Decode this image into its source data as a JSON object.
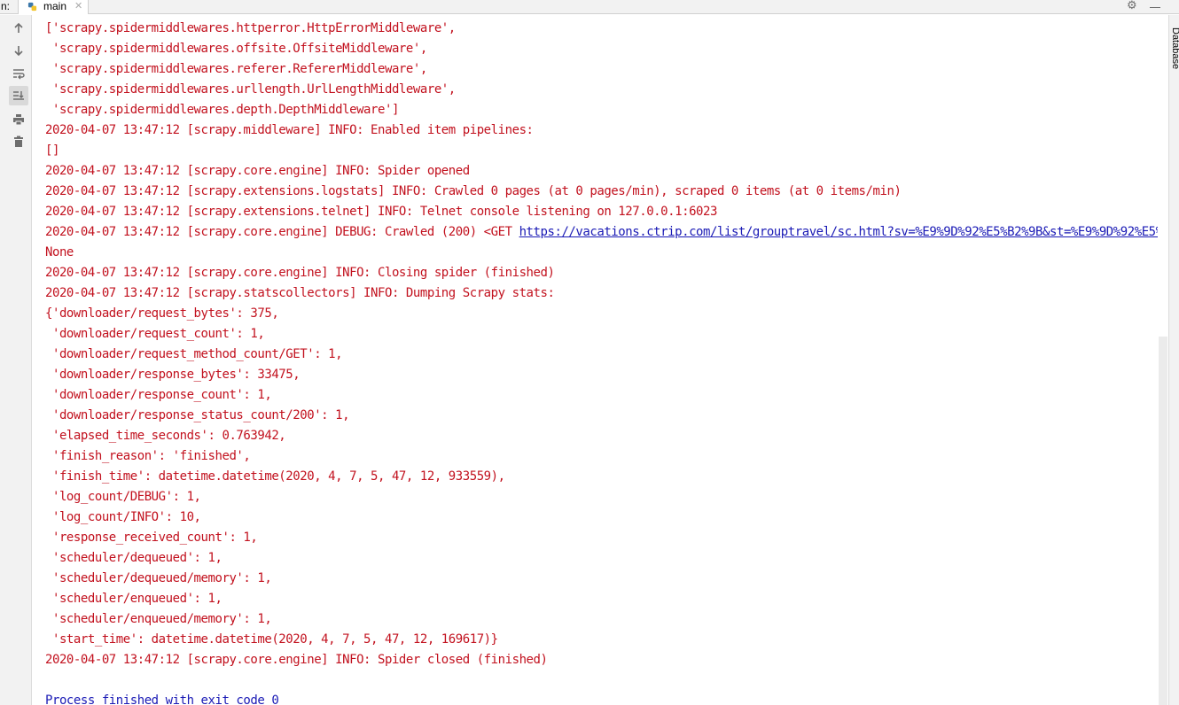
{
  "titlebar": {
    "run_label": "n:",
    "tab_label": "main",
    "close_glyph": "✕",
    "gear_glyph": "⚙"
  },
  "toolbar": {
    "buttons": [
      {
        "name": "up-arrow-icon",
        "active": false
      },
      {
        "name": "down-arrow-icon",
        "active": false
      },
      {
        "name": "soft-wrap-icon",
        "active": false
      },
      {
        "name": "scroll-to-end-icon",
        "active": true
      },
      {
        "name": "print-icon",
        "active": false
      },
      {
        "name": "trash-icon",
        "active": false
      }
    ]
  },
  "side_panel": {
    "label": "Database"
  },
  "console": {
    "lines": [
      {
        "text": "['scrapy.spidermiddlewares.httperror.HttpErrorMiddleware',"
      },
      {
        "text": " 'scrapy.spidermiddlewares.offsite.OffsiteMiddleware',"
      },
      {
        "text": " 'scrapy.spidermiddlewares.referer.RefererMiddleware',"
      },
      {
        "text": " 'scrapy.spidermiddlewares.urllength.UrlLengthMiddleware',"
      },
      {
        "text": " 'scrapy.spidermiddlewares.depth.DepthMiddleware']"
      },
      {
        "text": "2020-04-07 13:47:12 [scrapy.middleware] INFO: Enabled item pipelines:"
      },
      {
        "text": "[]"
      },
      {
        "text": "2020-04-07 13:47:12 [scrapy.core.engine] INFO: Spider opened"
      },
      {
        "text": "2020-04-07 13:47:12 [scrapy.extensions.logstats] INFO: Crawled 0 pages (at 0 pages/min), scraped 0 items (at 0 items/min)"
      },
      {
        "text": "2020-04-07 13:47:12 [scrapy.extensions.telnet] INFO: Telnet console listening on 127.0.0.1:6023"
      },
      {
        "text": "2020-04-07 13:47:12 [scrapy.core.engine] DEBUG: Crawled (200) <GET ",
        "link": "https://vacations.ctrip.com/list/grouptravel/sc.html?sv=%E9%9D%92%E5%B2%9B&st=%E9%9D%92%E5%B2%9B"
      },
      {
        "text": "None"
      },
      {
        "text": "2020-04-07 13:47:12 [scrapy.core.engine] INFO: Closing spider (finished)"
      },
      {
        "text": "2020-04-07 13:47:12 [scrapy.statscollectors] INFO: Dumping Scrapy stats:"
      },
      {
        "text": "{'downloader/request_bytes': 375,"
      },
      {
        "text": " 'downloader/request_count': 1,"
      },
      {
        "text": " 'downloader/request_method_count/GET': 1,"
      },
      {
        "text": " 'downloader/response_bytes': 33475,"
      },
      {
        "text": " 'downloader/response_count': 1,"
      },
      {
        "text": " 'downloader/response_status_count/200': 1,"
      },
      {
        "text": " 'elapsed_time_seconds': 0.763942,"
      },
      {
        "text": " 'finish_reason': 'finished',"
      },
      {
        "text": " 'finish_time': datetime.datetime(2020, 4, 7, 5, 47, 12, 933559),"
      },
      {
        "text": " 'log_count/DEBUG': 1,"
      },
      {
        "text": " 'log_count/INFO': 10,"
      },
      {
        "text": " 'response_received_count': 1,"
      },
      {
        "text": " 'scheduler/dequeued': 1,"
      },
      {
        "text": " 'scheduler/dequeued/memory': 1,"
      },
      {
        "text": " 'scheduler/enqueued': 1,"
      },
      {
        "text": " 'scheduler/enqueued/memory': 1,"
      },
      {
        "text": " 'start_time': datetime.datetime(2020, 4, 7, 5, 47, 12, 169617)}"
      },
      {
        "text": "2020-04-07 13:47:12 [scrapy.core.engine] INFO: Spider closed (finished)"
      },
      {
        "text": ""
      },
      {
        "text": "Process finished with exit code 0",
        "kind": "exit"
      }
    ]
  }
}
